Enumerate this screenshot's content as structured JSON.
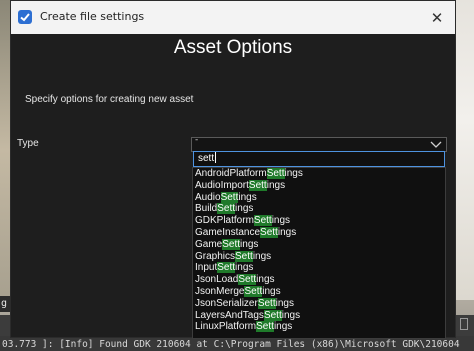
{
  "window": {
    "title": "Create file settings",
    "close_glyph": "✕"
  },
  "header": {
    "title": "Asset Options",
    "description": "Specify options for creating new asset"
  },
  "form": {
    "type_label": "Type",
    "combo_value": "-",
    "search_value": "sett"
  },
  "dropdown": {
    "items": [
      {
        "prefix": "AndroidPlatform",
        "match": "Sett",
        "suffix": "ings"
      },
      {
        "prefix": "AudioImport",
        "match": "Sett",
        "suffix": "ings"
      },
      {
        "prefix": "Audio",
        "match": "Sett",
        "suffix": "ings"
      },
      {
        "prefix": "Build",
        "match": "Sett",
        "suffix": "ings"
      },
      {
        "prefix": "GDKPlatform",
        "match": "Sett",
        "suffix": "ings"
      },
      {
        "prefix": "GameInstance",
        "match": "Sett",
        "suffix": "ings"
      },
      {
        "prefix": "Game",
        "match": "Sett",
        "suffix": "ings"
      },
      {
        "prefix": "Graphics",
        "match": "Sett",
        "suffix": "ings"
      },
      {
        "prefix": "Input",
        "match": "Sett",
        "suffix": "ings"
      },
      {
        "prefix": "JsonLoad",
        "match": "Sett",
        "suffix": "ings"
      },
      {
        "prefix": "JsonMerge",
        "match": "Sett",
        "suffix": "ings"
      },
      {
        "prefix": "JsonSerializer",
        "match": "Sett",
        "suffix": "ings"
      },
      {
        "prefix": "LayersAndTags",
        "match": "Sett",
        "suffix": "ings"
      },
      {
        "prefix": "LinuxPlatform",
        "match": "Sett",
        "suffix": "ings"
      }
    ]
  },
  "background": {
    "badge_text": "g",
    "console_line": "03.773 ]: [Info] Found GDK 210604 at C:\\Program Files (x86)\\Microsoft GDK\\210604"
  },
  "colors": {
    "dialog_bg": "#1e1e1e",
    "highlight": "#1f7a2a",
    "focus_border": "#4e93e0",
    "app_icon": "#2d6fd2"
  },
  "icons": [
    "app-icon",
    "close-icon",
    "chevron-down-icon"
  ]
}
